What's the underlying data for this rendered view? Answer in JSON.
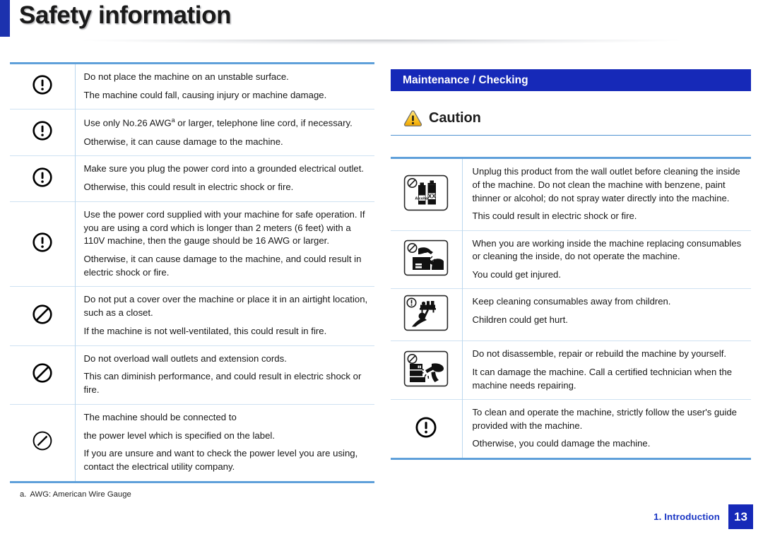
{
  "header": {
    "title": "Safety information",
    "accent_color": "#1C32AE"
  },
  "colors": {
    "heading_blue": "#1629B8",
    "rule_blue": "#5FA0DA",
    "row_divider": "#CFE2F2",
    "caution_yellow": "#FFC627"
  },
  "left_column": {
    "rows": [
      {
        "icon": "exclamation-circle-icon",
        "lines": [
          "Do not place the machine on an unstable surface.",
          "The machine could fall, causing injury or machine damage."
        ]
      },
      {
        "icon": "exclamation-circle-icon",
        "lines": [
          "Use only No.26 AWGa or larger, telephone line cord, if necessary.",
          "Otherwise, it can cause damage to the machine."
        ]
      },
      {
        "icon": "exclamation-circle-icon",
        "lines": [
          "Make sure you plug the power cord into a grounded electrical outlet.",
          "Otherwise, this could result in electric shock or fire."
        ]
      },
      {
        "icon": "exclamation-circle-icon",
        "lines": [
          "Use the power cord supplied with your machine for safe operation. If you are using a cord which is longer than 2 meters (6 feet) with a 110V machine, then the gauge should be 16 AWG or larger.",
          "Otherwise, it can cause damage to the machine, and could result in electric shock or fire."
        ]
      },
      {
        "icon": "prohibition-icon",
        "lines": [
          "Do not put a cover over the machine or place it in an airtight location, such as a closet.",
          "If the machine is not well-ventilated, this could result in fire."
        ]
      },
      {
        "icon": "prohibition-icon",
        "lines": [
          "Do not overload wall outlets and extension cords.",
          "This can diminish performance, and could result in electric shock or fire."
        ]
      },
      {
        "icon": "power-prohibition-icon",
        "lines": [
          "The machine should be connected to",
          "the power level which is specified on the label.",
          "If you are unsure and want to check the power level you are using, contact the electrical utility company."
        ]
      }
    ],
    "footnote_marker": "a.",
    "footnote_text": "AWG: American Wire Gauge"
  },
  "right_column": {
    "section_title": "Maintenance / Checking",
    "caution_label": "Caution",
    "caution_icon": "warning-triangle-icon",
    "rows": [
      {
        "icon": "no-solvent-bottles-icon",
        "lines": [
          "Unplug this product from the wall outlet before cleaning the inside of the machine. Do not clean the machine with benzene, paint thinner or alcohol; do not spray water directly into the machine.",
          "This could result in electric shock or fire."
        ]
      },
      {
        "icon": "no-hand-inside-machine-icon",
        "lines": [
          "When you are working inside the machine replacing consumables or cleaning the inside, do not operate the machine.",
          "You could get injured."
        ]
      },
      {
        "icon": "keep-away-from-children-icon",
        "lines": [
          "Keep cleaning consumables away from children.",
          "Children could get hurt."
        ]
      },
      {
        "icon": "no-disassemble-icon",
        "lines": [
          "Do not disassemble, repair or rebuild the machine by yourself.",
          "It can damage the machine. Call a certified technician when the machine needs repairing."
        ]
      },
      {
        "icon": "exclamation-circle-icon",
        "lines": [
          "To clean and operate the machine, strictly follow the user's guide provided with the machine.",
          "Otherwise, you could damage the machine."
        ]
      }
    ]
  },
  "footer": {
    "chapter": "1. Introduction",
    "page_number": "13"
  }
}
